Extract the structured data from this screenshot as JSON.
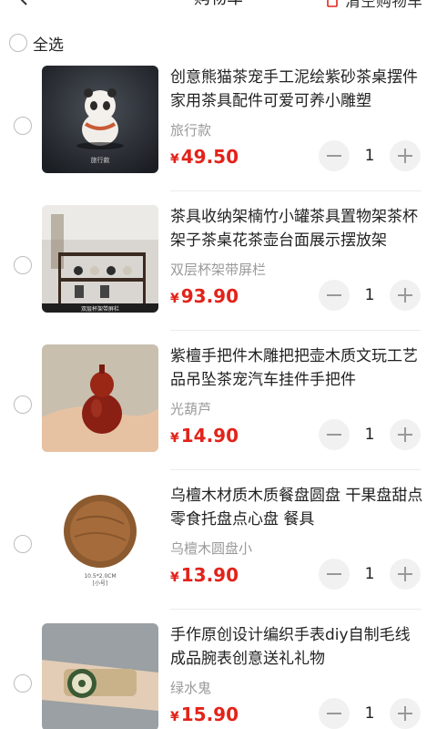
{
  "header": {
    "title": "购物车",
    "clear_label": "清空购物车"
  },
  "select_all": {
    "label": "全选"
  },
  "items": [
    {
      "title": "创意熊猫茶宠手工泥绘紫砂茶桌摆件家用茶具配件可爱可养小雕塑",
      "spec": "旅行款",
      "currency": "¥",
      "price": "49.50",
      "qty": "1",
      "thumb_caption": "旅行款"
    },
    {
      "title": "茶具收纳架楠竹小罐茶具置物架茶杯架子茶桌花茶壶台面展示摆放架",
      "spec": "双层杯架带屏栏",
      "currency": "¥",
      "price": "93.90",
      "qty": "1",
      "thumb_caption": "双层杯架带屏栏"
    },
    {
      "title": "紫檀手把件木雕把把壶木质文玩工艺品吊坠茶宠汽车挂件手把件",
      "spec": "光葫芦",
      "currency": "¥",
      "price": "14.90",
      "qty": "1"
    },
    {
      "title": "乌檀木材质木质餐盘圆盘 干果盘甜点零食托盘点心盘 餐具",
      "spec": "乌檀木圆盘小",
      "currency": "¥",
      "price": "13.90",
      "qty": "1",
      "thumb_caption": "10.5*2.0CM",
      "thumb_caption2": "[小号]"
    },
    {
      "title": "手作原创设计编织手表diy自制毛线成品腕表创意送礼礼物",
      "spec": "绿水鬼",
      "currency": "¥",
      "price": "15.90",
      "qty": "1"
    }
  ]
}
